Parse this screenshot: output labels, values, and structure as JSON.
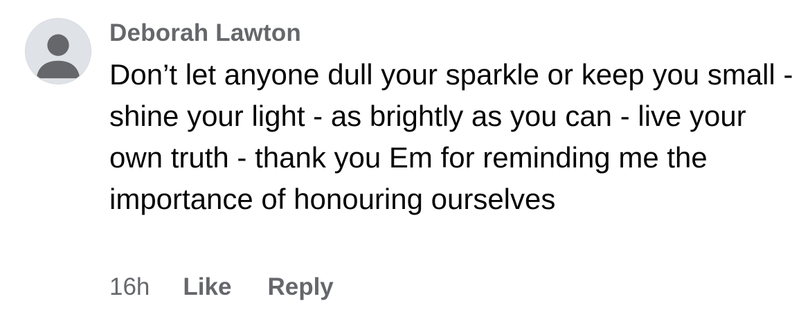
{
  "comment": {
    "author": "Deborah Lawton",
    "avatar_icon": "default-user-avatar-icon",
    "text": "Don’t let anyone dull your sparkle or keep you small - shine your light - as brightly as you can - live your own truth - thank you Em for reminding me the importance of honouring ourselves",
    "time": "16h",
    "actions": {
      "like_label": "Like",
      "reply_label": "Reply"
    }
  },
  "colors": {
    "secondary_text": "#65676b",
    "primary_text": "#050505",
    "avatar_bg": "#dfe2e6",
    "avatar_figure": "#65676b"
  }
}
